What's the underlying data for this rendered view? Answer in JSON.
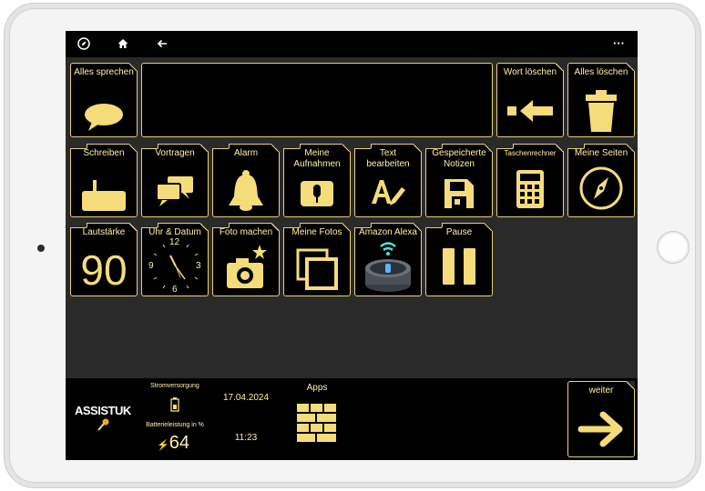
{
  "colors": {
    "accent": "#f5dc7a",
    "screen_bg": "#2a2a2a",
    "tile_bg": "#000000"
  },
  "topbar": {
    "icons": [
      "compass-icon",
      "home-icon",
      "back-arrow-icon",
      "more-icon"
    ],
    "more_label": "···"
  },
  "tiles": {
    "speak_all": "Alles sprechen",
    "delete_word": "Wort löschen",
    "delete_all": "Alles löschen",
    "write": "Schreiben",
    "recite": "Vortragen",
    "alarm": "Alarm",
    "my_recordings": "Meine Aufnahmen",
    "edit_text": "Text bearbeiten",
    "saved_notes": "Gespeicherte Notizen",
    "calculator": "Taschenrechner",
    "my_pages": "Meine Seiten",
    "volume": "Lautstärke",
    "volume_value": "90",
    "clock": "Uhr & Datum",
    "clock_numbers": [
      "12",
      "3",
      "6",
      "9"
    ],
    "take_photo": "Foto machen",
    "my_photos": "Meine Fotos",
    "alexa": "Amazon Alexa",
    "pause": "Pause"
  },
  "bottom": {
    "logo": "ASSISTUK",
    "power_label": "Stromversorgung",
    "battery_label": "Batterieleistung in %",
    "battery_value": "64",
    "date": "17.04.2024",
    "time": "11:23",
    "apps_label": "Apps",
    "next_label": "weiter"
  }
}
